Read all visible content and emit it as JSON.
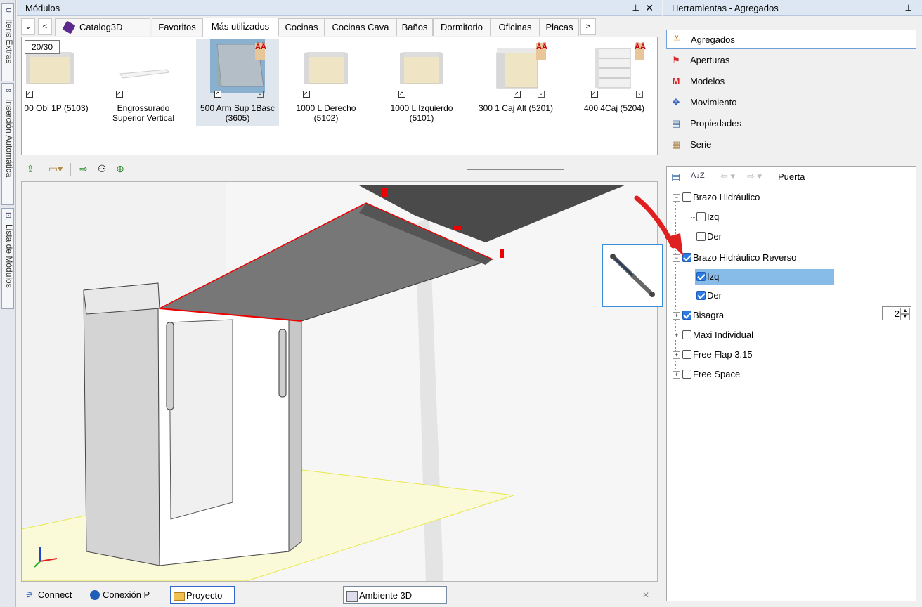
{
  "left_strip": {
    "tabs": [
      {
        "label": "Itens Extras",
        "icon": "paperclip-icon"
      },
      {
        "label": "Inserción Automática",
        "icon": "link-icon"
      },
      {
        "label": "Lista de Módulos",
        "icon": "list-icon"
      }
    ]
  },
  "modulos": {
    "title": "Módulos",
    "pin_glyph": "⊥",
    "close_glyph": "✕",
    "nav_down": "⌄",
    "nav_prev": "<",
    "nav_next": ">",
    "tabs": [
      "Catalog3D",
      "Favoritos",
      "Más utilizados",
      "Cocinas",
      "Cocinas Cava",
      "Baños",
      "Dormitorio",
      "Oficinas",
      "Placas"
    ],
    "active_tab": "Más utilizados",
    "page_counter": "20/30",
    "items": [
      {
        "line1": "00 Obl 1P (5103)",
        "line2": ""
      },
      {
        "line1": "Engrossurado",
        "line2": "Superior Vertical"
      },
      {
        "line1": "500 Arm Sup 1Basc",
        "line2": "(3605)"
      },
      {
        "line1": "1000 L Derecho",
        "line2": "(5102)"
      },
      {
        "line1": "1000 L Izquierdo",
        "line2": "(5101)"
      },
      {
        "line1": "300 1 Caj Alt (5201)",
        "line2": ""
      },
      {
        "line1": "400 4Caj (5204)",
        "line2": ""
      }
    ],
    "badge_text": "ĀĀ"
  },
  "status_bar": {
    "tabs": [
      "Connect",
      "Conexión P",
      "Proyecto"
    ],
    "active_tab": "Proyecto",
    "document_tab": "Ambiente 3D",
    "close_glyph": "✕"
  },
  "tools": {
    "title": "Herramientas - Agregados",
    "pin_glyph": "⊥",
    "items": [
      {
        "label": "Agregados",
        "icon": "agregados-icon",
        "color": "#c47a00"
      },
      {
        "label": "Aperturas",
        "icon": "aperturas-icon",
        "color": "#d62828"
      },
      {
        "label": "Modelos",
        "icon": "modelos-icon",
        "color": "#d62828"
      },
      {
        "label": "Movimiento",
        "icon": "movimiento-icon",
        "color": "#2f5fbf"
      },
      {
        "label": "Propiedades",
        "icon": "propiedades-icon",
        "color": "#3a6ea5"
      },
      {
        "label": "Serie",
        "icon": "serie-icon",
        "color": "#b08a4a"
      }
    ],
    "active_item": "Agregados",
    "props_toolbar": {
      "breadcrumb": "Puerta",
      "sort_glyph": "A↓Z"
    },
    "tree": [
      {
        "label": "Brazo Hidráulico",
        "checked": false,
        "level": 0,
        "expander": "−"
      },
      {
        "label": "Izq",
        "checked": false,
        "level": 1
      },
      {
        "label": "Der",
        "checked": false,
        "level": 1
      },
      {
        "label": "Brazo Hidráulico Reverso",
        "checked": true,
        "level": 0,
        "expander": "−"
      },
      {
        "label": "Izq",
        "checked": true,
        "level": 1,
        "selected": true
      },
      {
        "label": "Der",
        "checked": true,
        "level": 1
      },
      {
        "label": "Bisagra",
        "checked": true,
        "level": 0,
        "expander": "+",
        "spinner_value": "2"
      },
      {
        "label": "Maxi Individual",
        "checked": false,
        "level": 0,
        "expander": "+"
      },
      {
        "label": "Free Flap 3.15",
        "checked": false,
        "level": 0,
        "expander": "+"
      },
      {
        "label": "Free Space",
        "checked": false,
        "level": 0,
        "expander": "+"
      }
    ]
  },
  "colors": {
    "accent": "#3a8ed8",
    "selection": "#87bbe8",
    "arrow": "#e02020"
  }
}
